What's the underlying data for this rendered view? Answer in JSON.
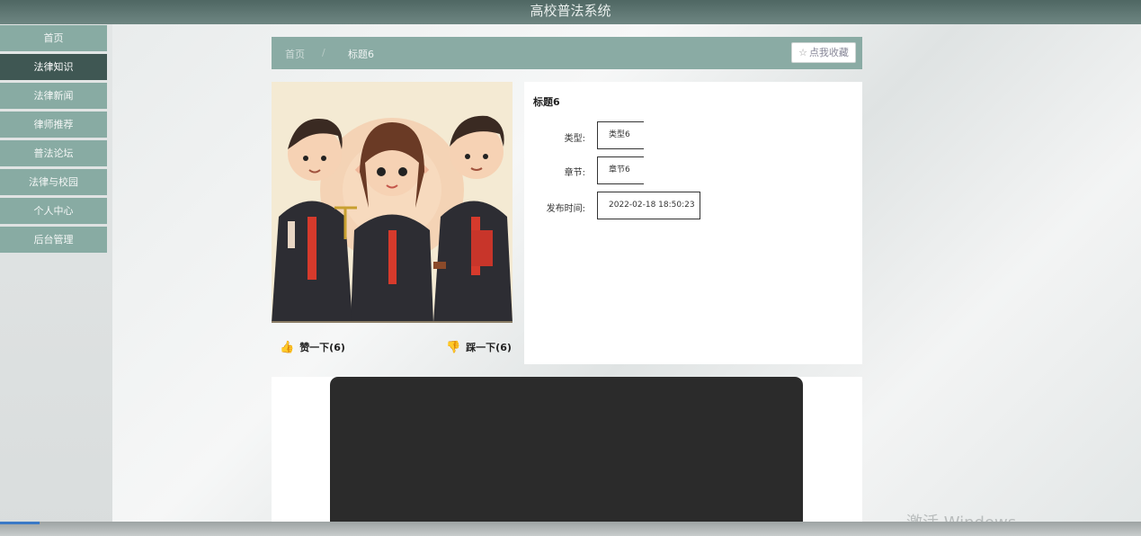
{
  "app": {
    "title": "高校普法系统"
  },
  "sidebar": {
    "items": [
      {
        "label": "首页"
      },
      {
        "label": "法律知识"
      },
      {
        "label": "法律新闻"
      },
      {
        "label": "律师推荐"
      },
      {
        "label": "普法论坛"
      },
      {
        "label": "法律与校园"
      },
      {
        "label": "个人中心"
      },
      {
        "label": "后台管理"
      }
    ],
    "active_index": 1
  },
  "breadcrumb": {
    "home": "首页",
    "separator": "/",
    "current": "标题6"
  },
  "favorite": {
    "icon": "star-icon",
    "label": "点我收藏"
  },
  "votes": {
    "up": {
      "icon": "thumbs-up-icon",
      "label": "赞一下(6)"
    },
    "down": {
      "icon": "thumbs-down-icon",
      "label": "踩一下(6)"
    }
  },
  "detail": {
    "title": "标题6",
    "fields": [
      {
        "label": "类型:",
        "value": "类型6"
      },
      {
        "label": "章节:",
        "value": "章节6"
      },
      {
        "label": "发布时间:",
        "value": "2022-02-18 18:50:23"
      }
    ]
  },
  "watermark": "激活 Windows",
  "colors": {
    "accent": "#88aba3",
    "active": "#3f5753",
    "vote": "#e0362a"
  }
}
